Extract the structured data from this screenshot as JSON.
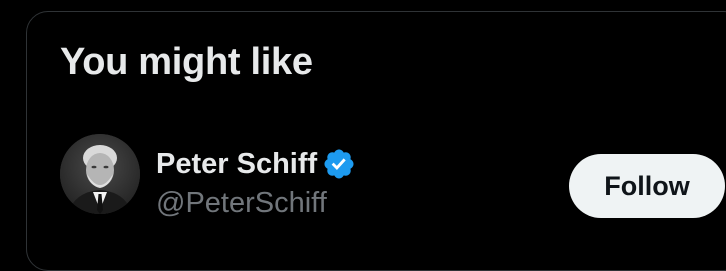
{
  "panel": {
    "title": "You might like"
  },
  "suggestion": {
    "name": "Peter Schiff",
    "handle": "@PeterSchiff",
    "verified": true,
    "verified_icon": "verified-badge-icon",
    "verified_color": "#1d9bf0",
    "follow_label": "Follow"
  }
}
